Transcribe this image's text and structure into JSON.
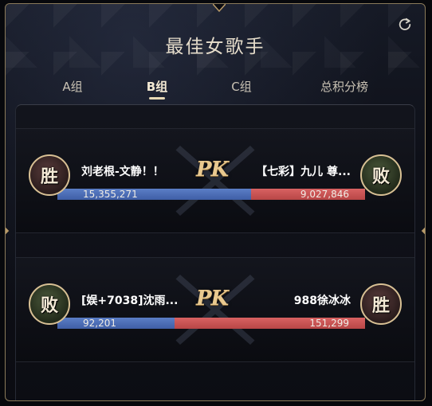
{
  "title": "最佳女歌手",
  "tabs": [
    {
      "label": "A组",
      "active": false
    },
    {
      "label": "B组",
      "active": true
    },
    {
      "label": "C组",
      "active": false
    },
    {
      "label": "总积分榜",
      "active": false
    }
  ],
  "icons": {
    "refresh": "refresh-icon"
  },
  "colors": {
    "blue": "#4a6cb5",
    "red": "#c24f4f",
    "gold": "#d8c094"
  },
  "pk_label": "PK",
  "matches": [
    {
      "left": {
        "name": "刘老根-文静！！",
        "score": "15,355,271",
        "result": "胜"
      },
      "right": {
        "name": "【七彩】九儿 尊...",
        "score": "9,027,846",
        "result": "败"
      },
      "blue_share": 0.63
    },
    {
      "left": {
        "name": "[娱+7038]沈雨...",
        "score": "92,201",
        "result": "败"
      },
      "right": {
        "name": "988徐冰冰",
        "score": "151,299",
        "result": "胜"
      },
      "blue_share": 0.38
    }
  ]
}
